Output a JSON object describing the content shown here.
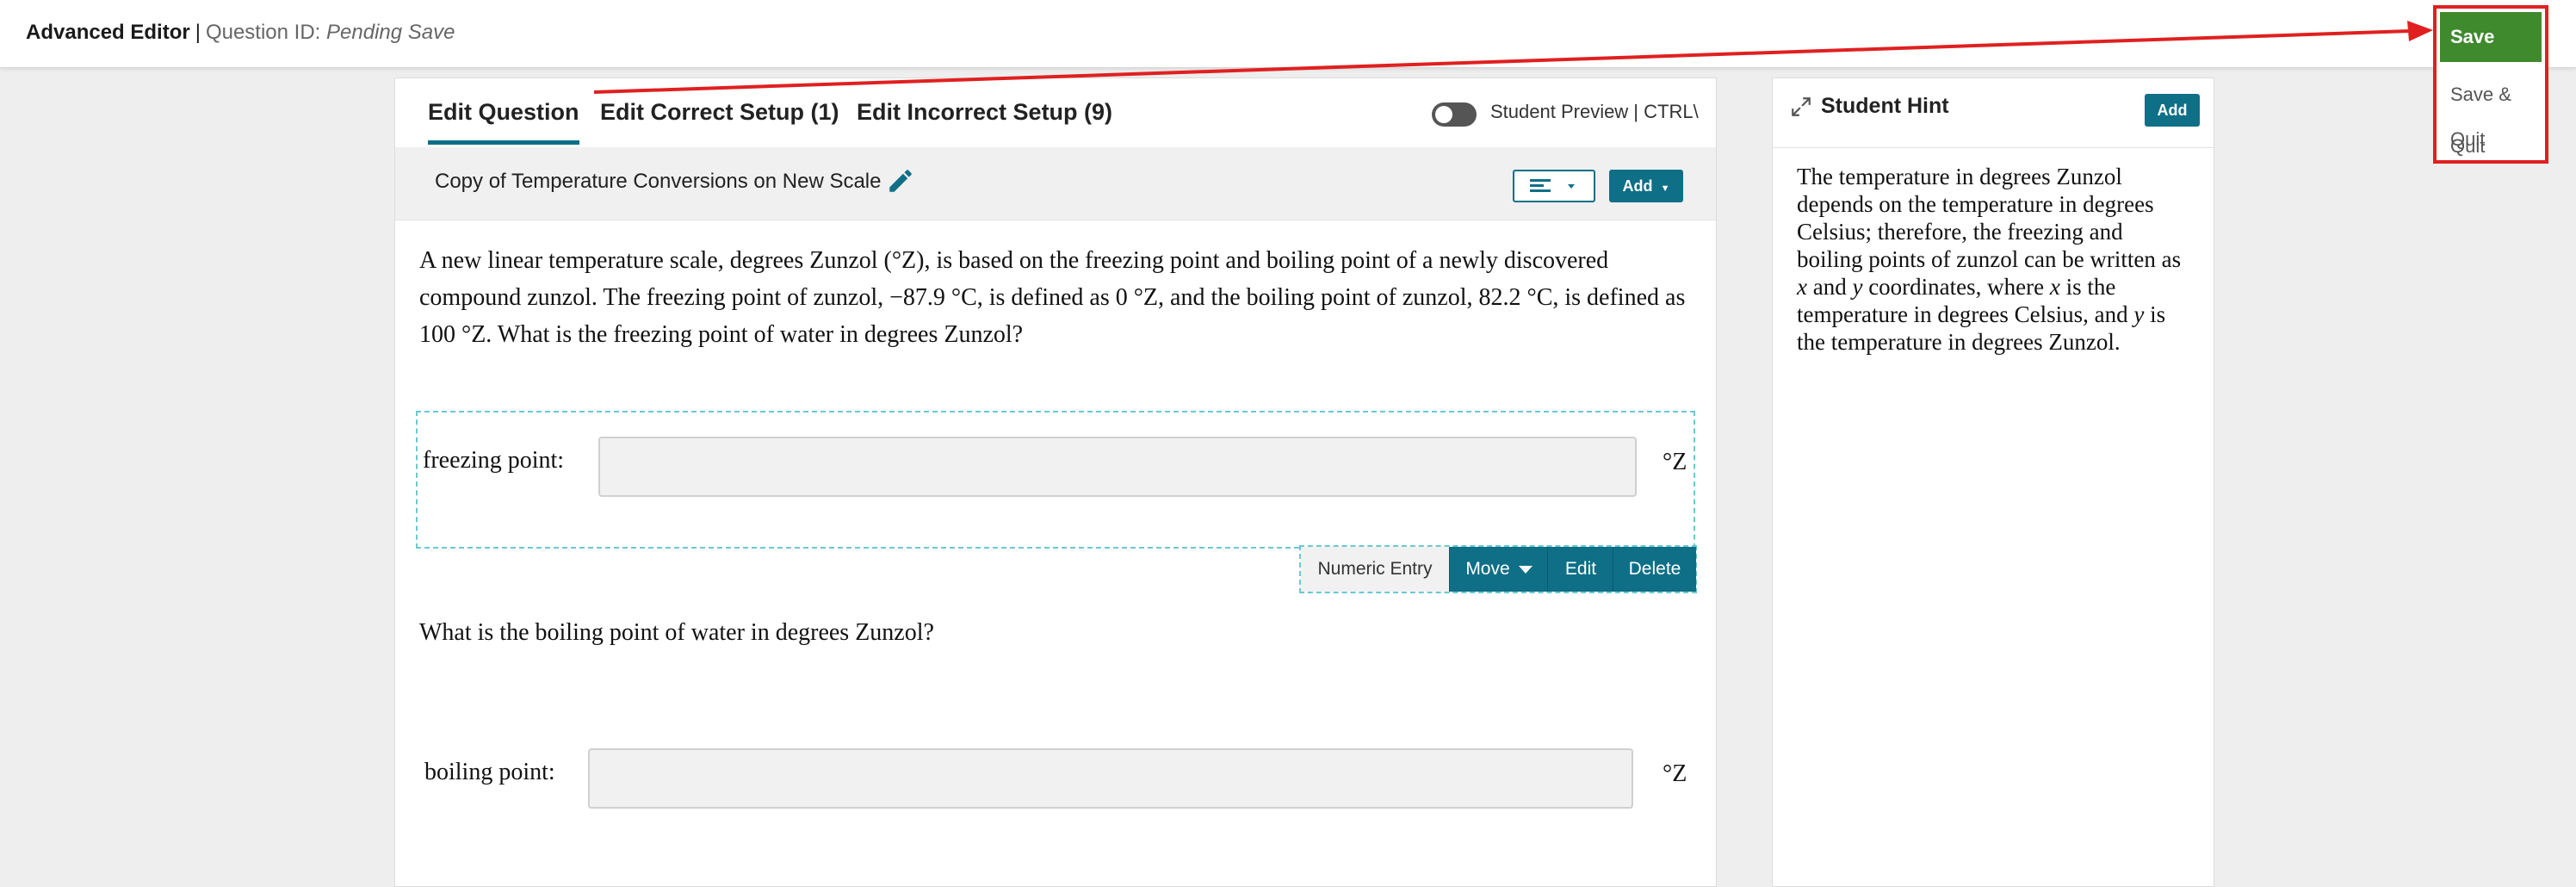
{
  "header": {
    "app_title": "Advanced Editor",
    "separator": "|",
    "question_id_label": "Question ID:",
    "question_id_value": "Pending Save"
  },
  "save_menu": {
    "save": "Save",
    "save_quit": "Save & Quit",
    "quit": "Quit"
  },
  "tabs": [
    {
      "label": "Edit Question",
      "active": true
    },
    {
      "label": "Edit Correct Setup (1)",
      "active": false
    },
    {
      "label": "Edit Incorrect Setup (9)",
      "active": false
    }
  ],
  "student_preview": {
    "label": "Student Preview | CTRL\\",
    "enabled": false
  },
  "question": {
    "title": "Copy of Temperature Conversions on New Scale",
    "add_label": "Add",
    "body": "A new linear temperature scale, degrees Zunzol (°Z), is based on the freezing point and boiling point of a newly discovered compound zunzol. The freezing point of zunzol, −87.9 °C, is defined as 0 °Z, and the boiling point of zunzol, 82.2 °C, is defined as 100 °Z. What is the freezing point of water in degrees Zunzol?",
    "second_prompt": "What is the boiling point of water in degrees Zunzol?"
  },
  "entries": [
    {
      "label": "freezing point:",
      "value": "",
      "unit": "°Z"
    },
    {
      "label": "boiling point:",
      "value": "",
      "unit": "°Z"
    }
  ],
  "entry_toolbar": {
    "type_label": "Numeric Entry",
    "move": "Move",
    "edit": "Edit",
    "delete": "Delete"
  },
  "hint": {
    "title": "Student Hint",
    "add_label": "Add",
    "text_1": "The temperature in degrees Zunzol depends on the temperature in degrees Celsius; therefore, the freezing and boiling points of zunzol can be written as ",
    "var_x": "x",
    "text_2": " and ",
    "var_y": "y",
    "text_3": " coordinates, where ",
    "text_4": " is the temperature in degrees Celsius, and ",
    "text_5": " is the temperature in degrees Zunzol."
  },
  "colors": {
    "accent": "#0e6f87",
    "save_green": "#3e8a2d",
    "annotation_red": "#e02020",
    "dashed_outline": "#69c9d3"
  }
}
